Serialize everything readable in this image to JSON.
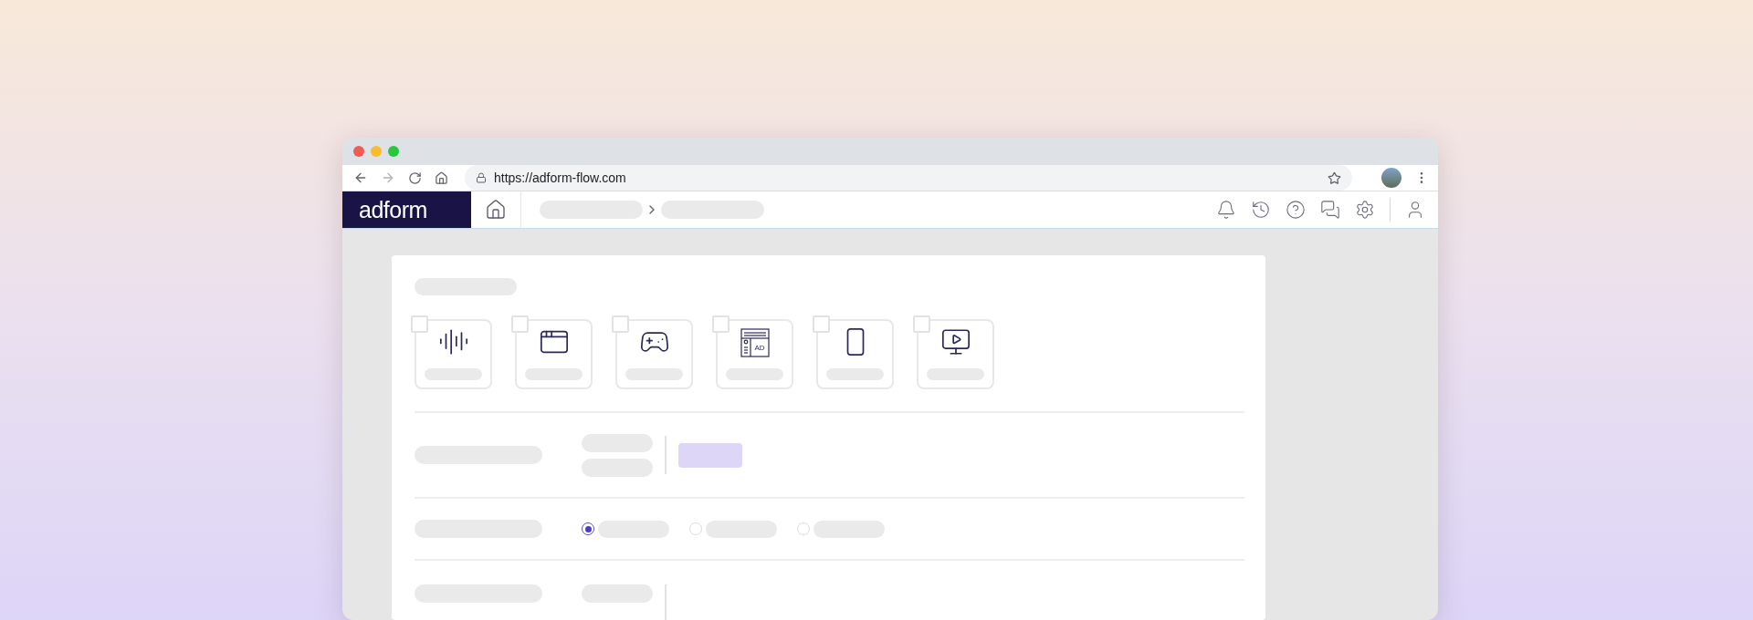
{
  "browser": {
    "url": "https://adform-flow.com"
  },
  "app_header": {
    "logo": "adform"
  },
  "format_tiles": [
    {
      "checked": false
    },
    {
      "checked": false
    },
    {
      "checked": false
    },
    {
      "checked": false,
      "icon_text": "AD"
    },
    {
      "checked": false
    },
    {
      "checked": false
    }
  ],
  "radio_options": [
    {
      "selected": true
    },
    {
      "selected": false
    },
    {
      "selected": false
    }
  ]
}
